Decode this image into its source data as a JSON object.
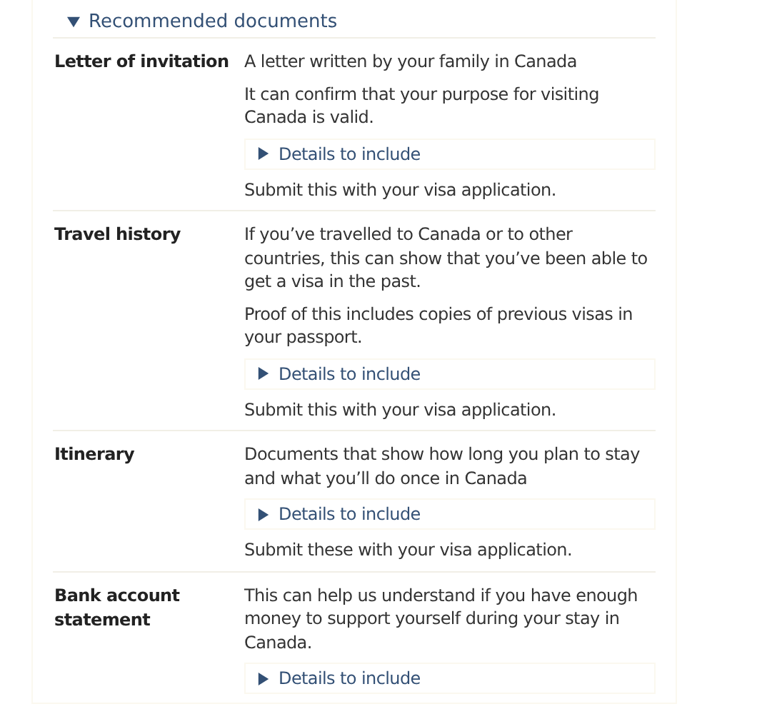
{
  "section": {
    "title": "Recommended documents",
    "expanded": true
  },
  "documents": [
    {
      "name": "Letter of invitation",
      "paragraphs": [
        "A letter written by your family in Canada",
        "It can confirm that your purpose for visiting Canada is valid."
      ],
      "details": {
        "label": "Details to include",
        "expanded": false
      },
      "note": "Submit this with your visa application."
    },
    {
      "name": "Travel history",
      "paragraphs": [
        "If you’ve travelled to Canada or to other countries, this can show that you’ve been able to get a visa in the past.",
        "Proof of this includes copies of previous visas in your passport."
      ],
      "details": {
        "label": "Details to include",
        "expanded": false
      },
      "note": "Submit this with your visa application."
    },
    {
      "name": "Itinerary",
      "paragraphs": [
        "Documents that show how long you plan to stay and what you’ll do once in Canada"
      ],
      "details": {
        "label": "Details to include",
        "expanded": false
      },
      "note": "Submit these with your visa application."
    },
    {
      "name": "Bank account statement",
      "paragraphs": [
        "This can help us understand if you have enough money to support yourself during your stay in Canada."
      ],
      "details": {
        "label": "Details to include",
        "expanded": false
      }
    }
  ]
}
